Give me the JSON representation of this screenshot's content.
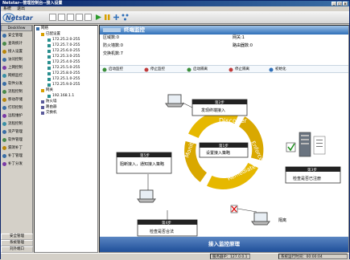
{
  "window": {
    "title": "Netstar--管理控制台--接入设置"
  },
  "menu": [
    "系统",
    "退出"
  ],
  "logo": {
    "text": "Netstar"
  },
  "leftnav": {
    "header": "DeskView",
    "items": [
      "安全管理",
      "查询统计",
      "接入设置",
      "访问控制",
      "上网控制",
      "网络监控",
      "软件分发",
      "流程控制",
      "移动存储",
      "打印控制",
      "远程维护",
      "流程控制",
      "资产管理",
      "软件管理",
      "漏洞补丁",
      "补丁管理",
      "补丁分发"
    ],
    "bottom": [
      "安全管理",
      "系统管理",
      "刘外端口"
    ]
  },
  "tree": {
    "root": "网络",
    "group1": "已配设置",
    "ranges": [
      "172.25.2.0-255",
      "172.25.7.0-255",
      "172.25.6.0-255",
      "172.25.3.0-255",
      "172.25.4.0-255",
      "172.25.5.0-255",
      "172.25.8.0-255",
      "172.25.1.0-255",
      "172.25.9.0-255"
    ],
    "group2": "网关",
    "gateway_ip": "192.168.1.1",
    "others": [
      "防火墙",
      "路由器",
      "交换机"
    ]
  },
  "main": {
    "header": "终端监控",
    "info": {
      "zone_label": "区域数:",
      "zone_value": "0",
      "gateway_label": "网关:",
      "gateway_value": "1",
      "firewall_label": "防火墙数:",
      "firewall_value": "0",
      "router_label": "路由器数:",
      "router_value": "0",
      "switch_label": "交换机数:",
      "switch_value": "7"
    },
    "actions": [
      "启动监控",
      "停止监控",
      "启动隔离",
      "停止隔离",
      "初始化"
    ],
    "footer": "接入监控原理"
  },
  "diagram": {
    "step1_title": "第1步",
    "step1_text": "设置接入策略",
    "step2_title": "第2步",
    "step2_text": "发现终端接入",
    "step3_title": "第3步",
    "step3_text": "检查是否已注册",
    "step4_title": "第4步",
    "step4_text": "检查是否合法",
    "step5_title": "第5步",
    "step5_text": "阻断接入，通知接入策略",
    "ring": [
      "Discover",
      "Enforce",
      "Remediate",
      "Monitor"
    ],
    "isolate_label": "隔离"
  },
  "status": {
    "server_label": "服务器IP：",
    "server_ip": "127.0.0.1",
    "time_label": "系统运行时间：",
    "time_value": "00:00:04"
  }
}
